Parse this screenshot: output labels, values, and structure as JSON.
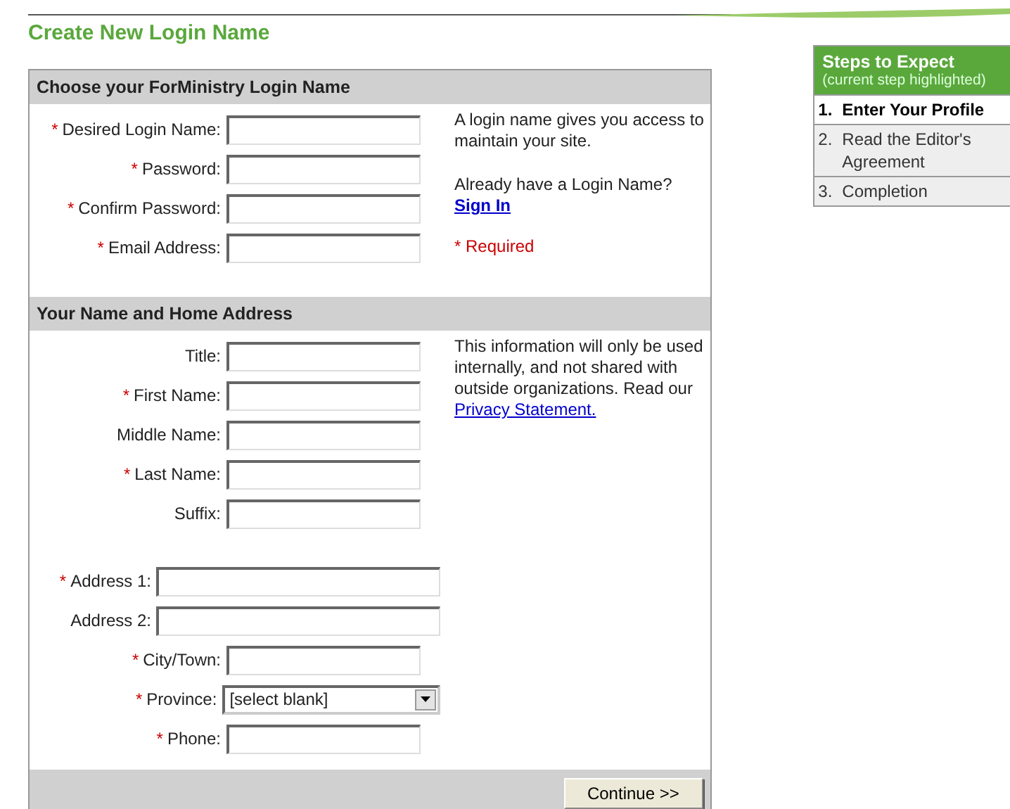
{
  "page_title": "Create New Login Name",
  "sections": [
    {
      "title": "Choose your ForMinistry Login Name",
      "groups": [
        {
          "fields": [
            {
              "marker": "*",
              "label": "Desired Login Name:",
              "kind": "short"
            },
            {
              "marker": "*",
              "label": "Password:",
              "kind": "short"
            },
            {
              "marker": "*",
              "label": "Confirm Password:",
              "kind": "short"
            },
            {
              "marker": "*",
              "label": "Email Address:",
              "kind": "short"
            }
          ]
        }
      ],
      "notes": [
        {
          "kind": "plain",
          "text": "A login name gives you access to maintain your site."
        },
        {
          "kind": "link_below",
          "text": "Already have a Login Name?",
          "link": "Sign In"
        },
        {
          "kind": "required",
          "text": "* Required"
        }
      ]
    },
    {
      "title": "Your Name and Home Address",
      "groups": [
        {
          "fields": [
            {
              "label": "Title:",
              "kind": "short"
            },
            {
              "marker": "*",
              "label": "First Name:",
              "kind": "short"
            },
            {
              "label": "Middle Name:",
              "kind": "short"
            },
            {
              "marker": "*",
              "label": "Last Name:",
              "kind": "short"
            },
            {
              "label": "Suffix:",
              "kind": "short"
            }
          ]
        },
        {
          "fields": [
            {
              "marker": "*",
              "label": "Address 1:",
              "kind": "long"
            },
            {
              "label": "Address 2:",
              "kind": "long"
            },
            {
              "marker": "*",
              "label": "City/Town:",
              "kind": "short"
            },
            {
              "marker": "*",
              "label": "Province:",
              "kind": "select",
              "value": "[select blank]"
            },
            {
              "marker": "*",
              "label": "Phone:",
              "kind": "short"
            }
          ]
        }
      ],
      "notes": [
        {
          "kind": "link_inline",
          "text": "This information will only be used internally, and not shared with outside organizations. Read our",
          "link": "Privacy Statement."
        }
      ]
    }
  ],
  "continue_button": "Continue >>",
  "steps": {
    "title": "Steps to Expect",
    "subtitle": "(current step highlighted)",
    "items": [
      {
        "number": "1.",
        "label": "Enter Your Profile",
        "selected": true
      },
      {
        "number": "2.",
        "label": "Read the Editor's Agreement",
        "selected": false
      },
      {
        "number": "3.",
        "label": "Completion",
        "selected": false
      }
    ]
  }
}
